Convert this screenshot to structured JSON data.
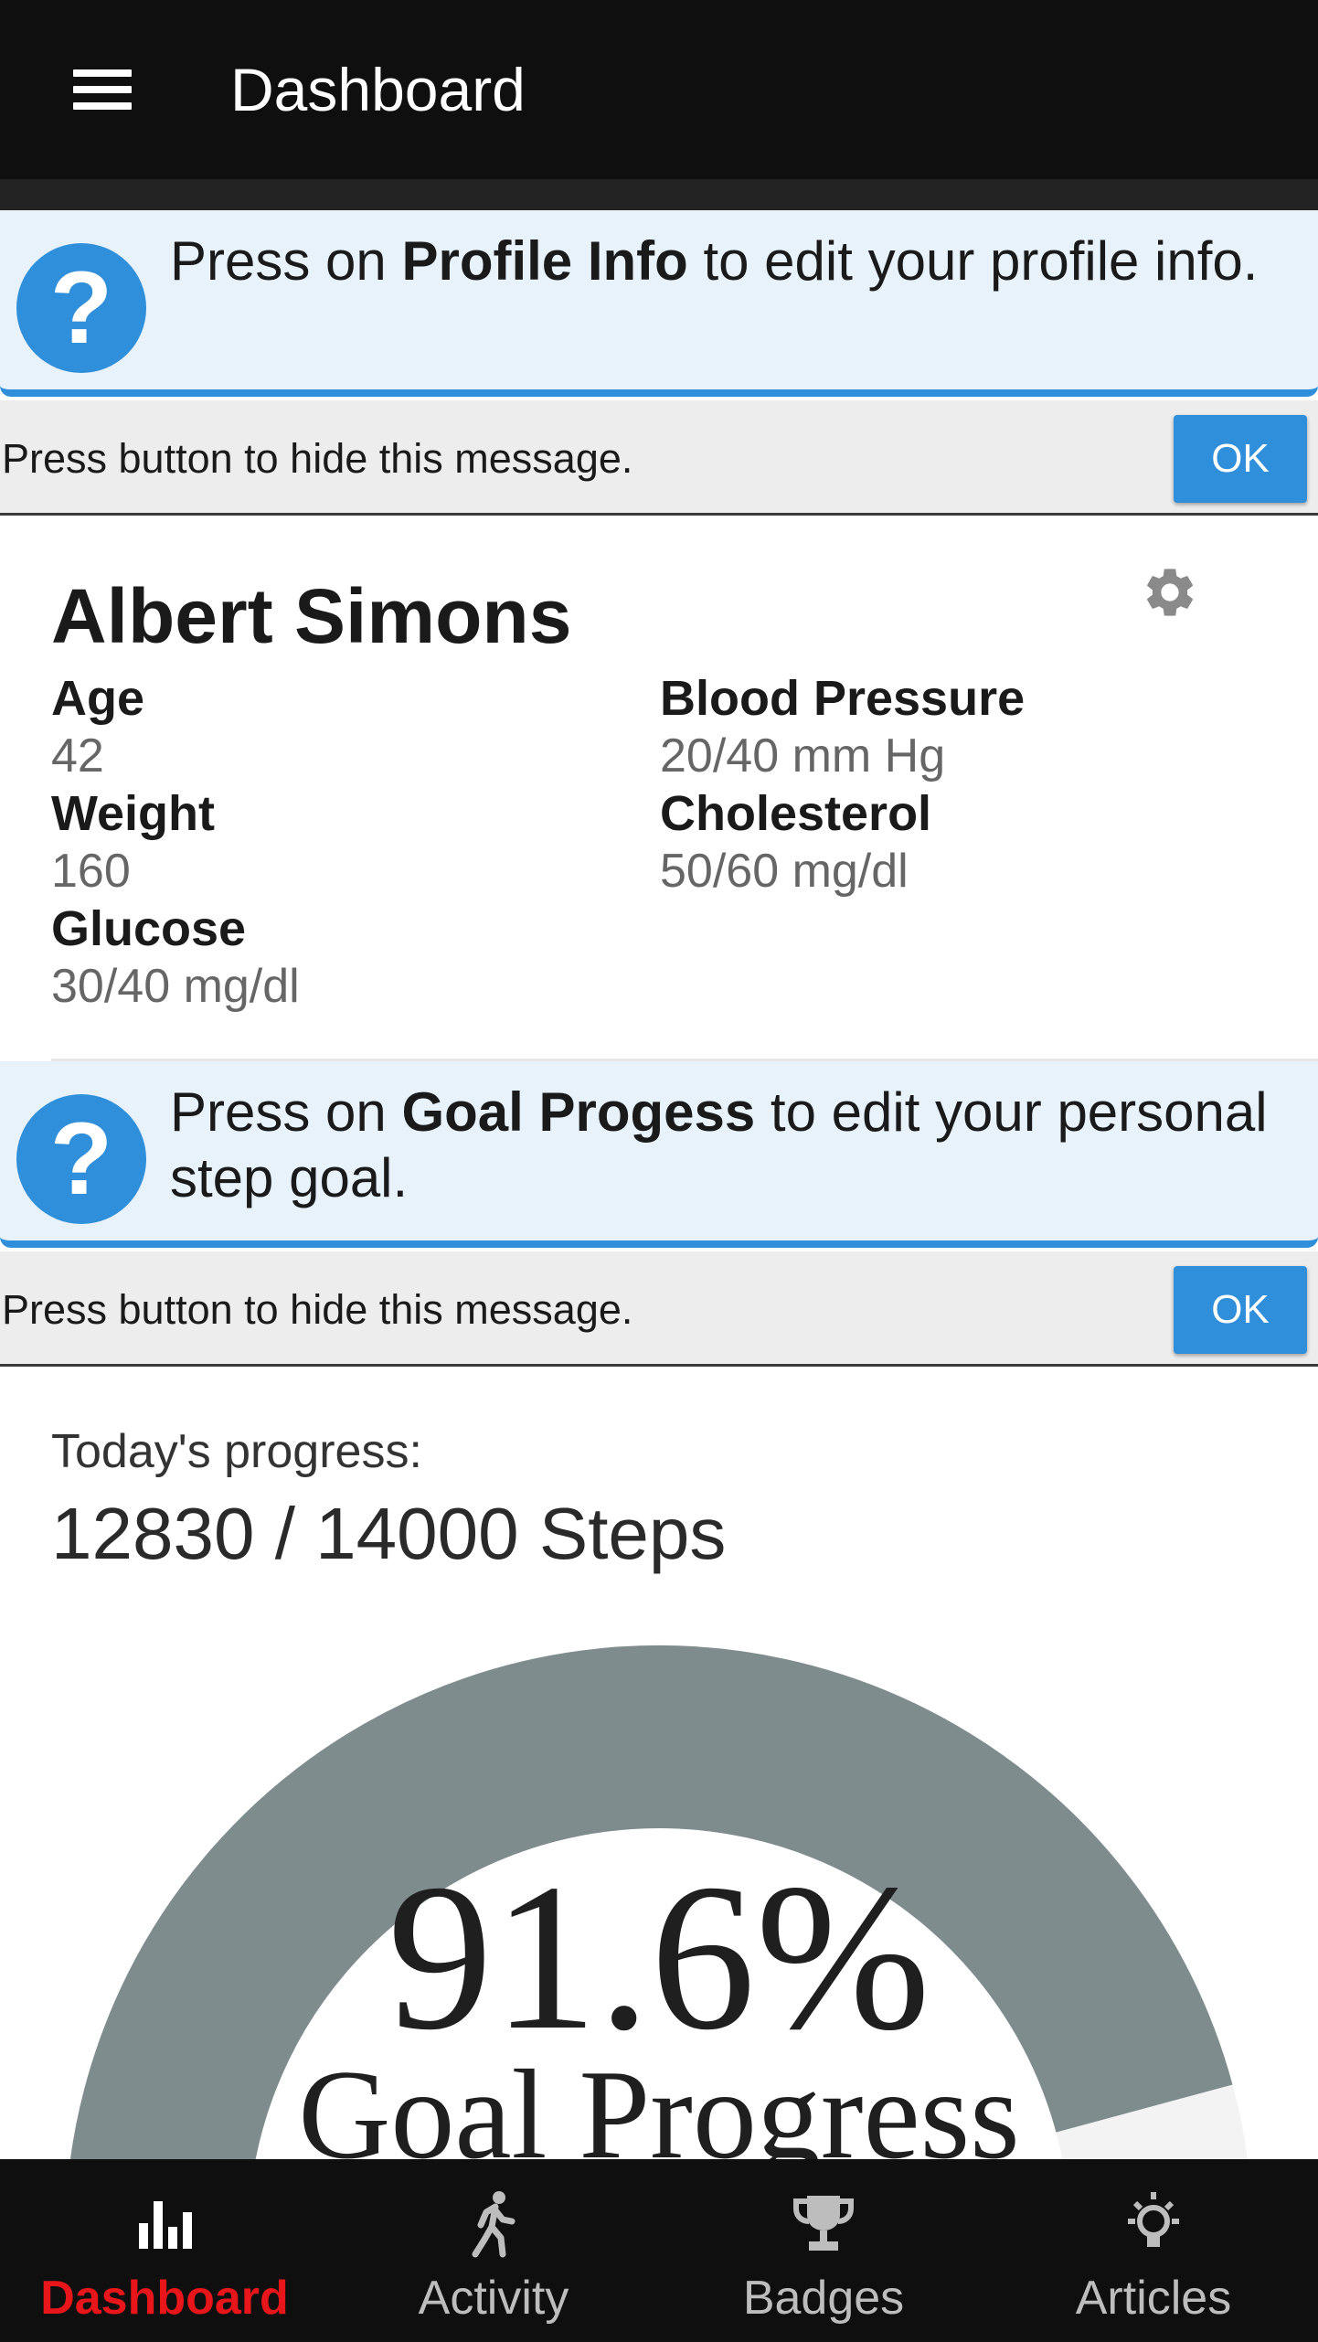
{
  "appbar": {
    "title": "Dashboard"
  },
  "help_profile": {
    "prefix": "Press on ",
    "bold": "Profile Info",
    "suffix": " to edit your profile info.",
    "hide_text": "Press button to hide this message.",
    "ok_label": "OK"
  },
  "profile": {
    "name": "Albert Simons",
    "fields": {
      "age": {
        "label": "Age",
        "value": "42"
      },
      "weight": {
        "label": "Weight",
        "value": "160"
      },
      "glucose": {
        "label": "Glucose",
        "value": "30/40 mg/dl"
      },
      "blood_pressure": {
        "label": "Blood Pressure",
        "value": "20/40 mm Hg"
      },
      "cholesterol": {
        "label": "Cholesterol",
        "value": "50/60 mg/dl"
      }
    }
  },
  "help_goal": {
    "prefix": "Press on ",
    "bold": "Goal Progess",
    "suffix": " to edit your personal step goal.",
    "hide_text": "Press button to hide this message.",
    "ok_label": "OK"
  },
  "progress": {
    "label": "Today's progress:",
    "steps_text": "12830 / 14000 Steps",
    "steps": 12830,
    "goal": 14000,
    "percent_text": "91.6%",
    "caption": "Goal Progress",
    "percent": 91.6
  },
  "colors": {
    "accent": "#2f8fdb",
    "gauge_fill": "#7f8c8d",
    "gauge_track": "#f3f3f3",
    "active_nav": "#e8161b",
    "bar": "#0f0f0f"
  },
  "nav": {
    "items": [
      {
        "label": "Dashboard",
        "icon": "bar-chart-icon",
        "active": true
      },
      {
        "label": "Activity",
        "icon": "walking-icon",
        "active": false
      },
      {
        "label": "Badges",
        "icon": "trophy-icon",
        "active": false
      },
      {
        "label": "Articles",
        "icon": "lightbulb-icon",
        "active": false
      }
    ]
  }
}
